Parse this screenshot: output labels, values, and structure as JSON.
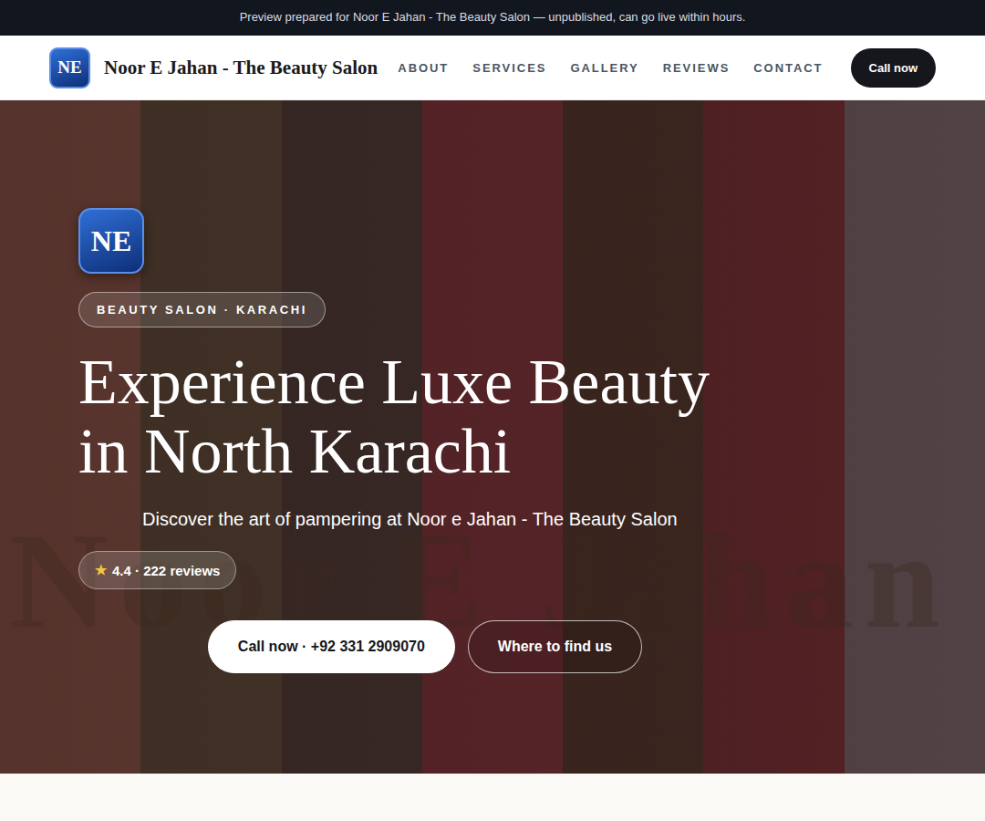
{
  "banner": "Preview prepared for Noor E Jahan - The Beauty Salon — unpublished, can go live within hours.",
  "brand": {
    "initials": "NE",
    "name": "Noor E Jahan - The Beauty Salon"
  },
  "nav": {
    "links": [
      "ABOUT",
      "SERVICES",
      "GALLERY",
      "REVIEWS",
      "CONTACT"
    ],
    "cta": "Call now"
  },
  "hero": {
    "initials": "NE",
    "eyebrow": "BEAUTY SALON · KARACHI",
    "title_lines": [
      "Experience Luxe Beauty",
      "in North Karachi"
    ],
    "subtitle": "Discover the art of pampering at Noor e Jahan - The Beauty Salon",
    "rating": {
      "star": "★",
      "text": "4.4 · 222 reviews"
    },
    "buttons": [
      {
        "label": "Call now · +92 331 2909070",
        "kind": "primary"
      },
      {
        "label": "Where to find us",
        "kind": "outline"
      }
    ],
    "watermark": "Noor E Jahan"
  }
}
